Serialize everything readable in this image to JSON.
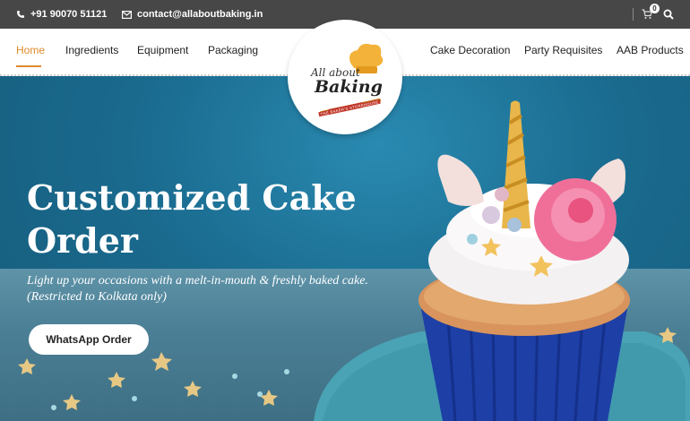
{
  "topbar": {
    "phone": "+91 90070 51121",
    "email": "contact@allaboutbaking.in",
    "cart_count": "0"
  },
  "nav": {
    "left": [
      "Home",
      "Ingredients",
      "Equipment",
      "Packaging"
    ],
    "right": [
      "Cake Decoration",
      "Party Requisites",
      "AAB Products"
    ]
  },
  "logo": {
    "line1": "All about",
    "line2": "Baking",
    "tagline": "THE BAKER'S STOREHOUSE"
  },
  "hero": {
    "title_line1": "Customized Cake",
    "title_line2": "Order",
    "subtitle_line1": "Light up your occasions with a melt-in-mouth & freshly baked cake.",
    "subtitle_line2": "(Restricted to Kolkata only)",
    "button": "WhatsApp Order"
  },
  "colors": {
    "topbar": "#474747",
    "accent": "#e08a2c",
    "hero": "#1d6f92"
  }
}
